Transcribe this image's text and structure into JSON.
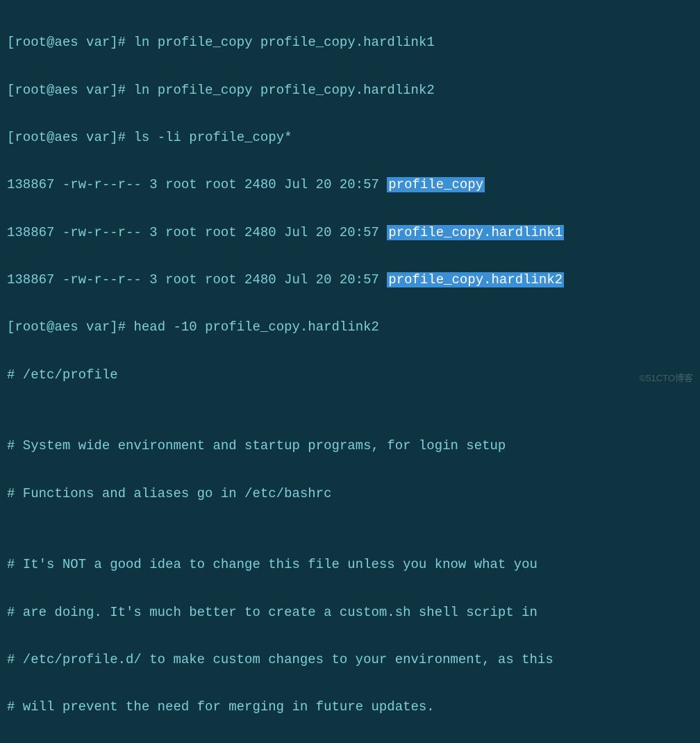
{
  "prompt": {
    "user": "root",
    "at": "@",
    "host": "aes",
    "dir": "var",
    "open": "[",
    "close": "]#"
  },
  "commands": {
    "cmd1": "ln profile_copy profile_copy.hardlink1",
    "cmd2": "ln profile_copy profile_copy.hardlink2",
    "cmd3": "ls -li profile_copy*",
    "cmd4": "head -10 profile_copy.hardlink2"
  },
  "lsOutput": {
    "row1": {
      "stats": "138867 -rw-r--r-- 3 root root 2480 Jul 20 20:57 ",
      "filename": "profile_copy"
    },
    "row2": {
      "stats": "138867 -rw-r--r-- 3 root root 2480 Jul 20 20:57 ",
      "filename": "profile_copy.hardlink1"
    },
    "row3": {
      "stats": "138867 -rw-r--r-- 3 root root 2480 Jul 20 20:57 ",
      "filename": "profile_copy.hardlink2"
    }
  },
  "headOutput": {
    "line1": "# /etc/profile",
    "line2": "",
    "line3": "# System wide environment and startup programs, for login setup",
    "line4": "# Functions and aliases go in /etc/bashrc",
    "line5": "",
    "line6": "# It's NOT a good idea to change this file unless you know what you",
    "line7": "# are doing. It's much better to create a custom.sh shell script in",
    "line8": "# /etc/profile.d/ to make custom changes to your environment, as this",
    "line9": "# will prevent the need for merging in future updates."
  },
  "watermark": "©51CTO博客"
}
